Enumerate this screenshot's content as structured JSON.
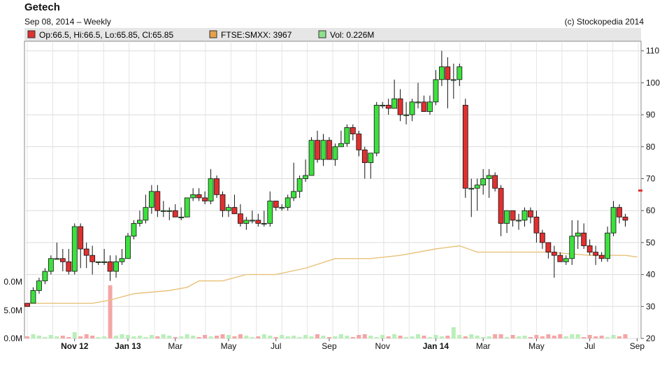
{
  "header": {
    "title": "Getech",
    "subtitle": "Sep 08, 2014 – Weekly",
    "copyright": "(c) Stockopedia 2014"
  },
  "legend": [
    {
      "label": "Op:66.5, Hi:66.5, Lo:65.85, Cl:65.85",
      "color": "#e03030"
    },
    {
      "label": "FTSE:SMXX: 3967",
      "color": "#e6a04a"
    },
    {
      "label": "Vol: 0.226M",
      "color": "#8ee08e"
    }
  ],
  "chart_data": {
    "type": "candlestick",
    "y_right_ticks": [
      "110",
      "100",
      "90",
      "80",
      "70",
      "60",
      "50",
      "40",
      "30",
      "20"
    ],
    "y_right_range": [
      20,
      113
    ],
    "y_left_ticks": [
      "0.0M",
      "5.0M",
      "0.0M"
    ],
    "x_ticks": [
      {
        "label": "Nov 12",
        "week": 8,
        "bold": true
      },
      {
        "label": "Jan 13",
        "week": 17,
        "bold": true
      },
      {
        "label": "Mar",
        "week": 25,
        "bold": false
      },
      {
        "label": "May",
        "week": 34,
        "bold": false
      },
      {
        "label": "Jul",
        "week": 42,
        "bold": false
      },
      {
        "label": "Sep",
        "week": 51,
        "bold": false
      },
      {
        "label": "Nov",
        "week": 60,
        "bold": false
      },
      {
        "label": "Jan 14",
        "week": 69,
        "bold": true
      },
      {
        "label": "Mar",
        "week": 77,
        "bold": false
      },
      {
        "label": "May",
        "week": 86,
        "bold": false
      },
      {
        "label": "Jul",
        "week": 95,
        "bold": false
      },
      {
        "label": "Sep",
        "week": 103,
        "bold": false
      }
    ],
    "candles": [
      [
        31,
        31,
        30,
        30
      ],
      [
        31,
        36,
        31,
        35
      ],
      [
        35,
        39,
        34,
        38
      ],
      [
        38,
        42,
        37,
        41
      ],
      [
        41,
        46,
        40,
        45
      ],
      [
        45,
        50,
        45,
        45
      ],
      [
        45,
        48,
        41,
        44
      ],
      [
        44,
        48,
        40,
        41
      ],
      [
        41,
        56,
        40,
        55
      ],
      [
        55,
        56,
        42,
        48
      ],
      [
        48,
        50,
        42,
        46
      ],
      [
        46,
        49,
        40,
        44
      ],
      [
        44,
        44,
        43,
        44
      ],
      [
        44,
        48,
        43,
        44
      ],
      [
        44,
        46,
        38,
        41
      ],
      [
        41,
        46,
        39,
        44
      ],
      [
        44,
        48,
        43,
        45
      ],
      [
        45,
        53,
        45,
        52
      ],
      [
        52,
        57,
        51,
        56
      ],
      [
        56,
        60,
        55,
        57
      ],
      [
        57,
        65,
        56,
        61
      ],
      [
        61,
        68,
        59,
        66
      ],
      [
        66,
        68,
        58,
        60
      ],
      [
        60,
        63,
        58,
        60
      ],
      [
        60,
        61,
        57,
        60
      ],
      [
        60,
        62,
        58,
        58
      ],
      [
        58,
        61,
        57,
        58
      ],
      [
        58,
        64,
        58,
        64
      ],
      [
        64,
        67,
        63,
        65
      ],
      [
        65,
        67,
        63,
        64
      ],
      [
        64,
        66,
        62,
        63
      ],
      [
        63,
        73,
        62,
        70
      ],
      [
        70,
        71,
        64,
        65
      ],
      [
        65,
        66,
        58,
        60
      ],
      [
        60,
        62,
        58,
        61
      ],
      [
        61,
        65,
        59,
        59
      ],
      [
        59,
        62,
        55,
        56
      ],
      [
        56,
        58,
        54,
        57
      ],
      [
        57,
        60,
        56,
        57
      ],
      [
        57,
        59,
        55,
        56
      ],
      [
        56,
        60,
        55,
        56
      ],
      [
        56,
        66,
        55,
        63
      ],
      [
        63,
        63,
        60,
        61
      ],
      [
        61,
        62,
        60,
        61
      ],
      [
        61,
        65,
        60,
        64
      ],
      [
        64,
        75,
        63,
        66
      ],
      [
        66,
        71,
        64,
        70
      ],
      [
        70,
        76,
        69,
        71
      ],
      [
        71,
        83,
        71,
        82
      ],
      [
        82,
        85,
        75,
        76
      ],
      [
        76,
        84,
        74,
        82
      ],
      [
        82,
        83,
        77,
        76
      ],
      [
        76,
        81,
        74,
        80
      ],
      [
        80,
        85,
        80,
        81
      ],
      [
        81,
        87,
        80,
        86
      ],
      [
        86,
        87,
        82,
        84
      ],
      [
        84,
        85,
        77,
        79
      ],
      [
        79,
        80,
        70,
        75
      ],
      [
        75,
        77,
        70,
        78
      ],
      [
        78,
        94,
        77,
        93
      ],
      [
        93,
        94,
        92,
        93
      ],
      [
        93,
        95,
        90,
        92
      ],
      [
        92,
        101,
        92,
        95
      ],
      [
        95,
        98,
        88,
        90
      ],
      [
        90,
        94,
        87,
        90
      ],
      [
        90,
        95,
        88,
        94
      ],
      [
        94,
        100,
        92,
        94
      ],
      [
        94,
        96,
        91,
        91
      ],
      [
        91,
        96,
        90,
        94
      ],
      [
        94,
        104,
        93,
        101
      ],
      [
        101,
        110,
        99,
        105
      ],
      [
        105,
        108,
        92,
        101
      ],
      [
        101,
        106,
        95,
        101
      ],
      [
        101,
        106,
        99,
        105
      ],
      [
        93,
        95,
        64,
        67
      ],
      [
        67,
        70,
        58,
        67
      ],
      [
        67,
        70,
        60,
        68
      ],
      [
        68,
        73,
        65,
        70
      ],
      [
        70,
        73,
        64,
        71
      ],
      [
        71,
        72,
        66,
        67
      ],
      [
        67,
        68,
        52,
        56
      ],
      [
        56,
        60,
        53,
        60
      ],
      [
        60,
        60,
        55,
        57
      ],
      [
        57,
        59,
        54,
        57
      ],
      [
        57,
        61,
        55,
        60
      ],
      [
        60,
        61,
        56,
        58
      ],
      [
        58,
        60,
        50,
        53
      ],
      [
        53,
        54,
        48,
        50
      ],
      [
        50,
        50,
        45,
        47
      ],
      [
        47,
        49,
        39,
        46
      ],
      [
        46,
        47,
        44,
        44
      ],
      [
        44,
        46,
        43,
        45
      ],
      [
        45,
        57,
        43,
        52
      ],
      [
        52,
        57,
        48,
        53
      ],
      [
        53,
        56,
        48,
        49
      ],
      [
        49,
        51,
        46,
        47
      ],
      [
        47,
        49,
        43,
        46
      ],
      [
        46,
        47,
        44,
        45
      ],
      [
        45,
        55,
        44,
        53
      ],
      [
        53,
        63,
        52,
        61
      ],
      [
        61,
        62,
        56,
        58
      ],
      [
        58,
        59,
        55,
        57
      ]
    ],
    "volume_red": [
      8,
      14
    ],
    "volume_max_week": 14,
    "ftse_line": [
      [
        0,
        31
      ],
      [
        5,
        31
      ],
      [
        11,
        31
      ],
      [
        14,
        32
      ],
      [
        18,
        34
      ],
      [
        24,
        35
      ],
      [
        27,
        36
      ],
      [
        29,
        38
      ],
      [
        33,
        38
      ],
      [
        37,
        40
      ],
      [
        42,
        40
      ],
      [
        47,
        42
      ],
      [
        52,
        45
      ],
      [
        58,
        45
      ],
      [
        63,
        46
      ],
      [
        69,
        48
      ],
      [
        73,
        49
      ],
      [
        76,
        47
      ],
      [
        81,
        47
      ],
      [
        88,
        47
      ],
      [
        95,
        46
      ],
      [
        101,
        46
      ],
      [
        103,
        45.5
      ]
    ]
  }
}
